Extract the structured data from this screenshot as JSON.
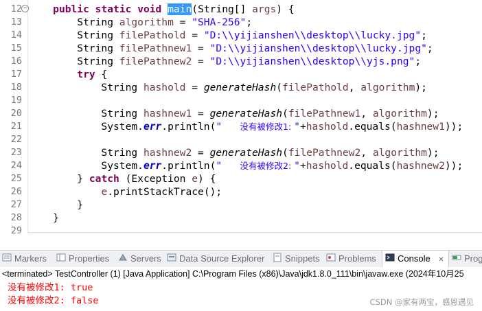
{
  "editor": {
    "lines": [
      {
        "num": "12",
        "tokens": [
          {
            "t": "    "
          },
          {
            "t": "public",
            "c": "kw"
          },
          {
            "t": " "
          },
          {
            "t": "static",
            "c": "kw"
          },
          {
            "t": " "
          },
          {
            "t": "void",
            "c": "kw"
          },
          {
            "t": " "
          },
          {
            "t": "main",
            "c": "sel"
          },
          {
            "t": "(String[] "
          },
          {
            "t": "args",
            "c": "var"
          },
          {
            "t": ") {"
          }
        ]
      },
      {
        "num": "13",
        "tokens": [
          {
            "t": "        String "
          },
          {
            "t": "algorithm",
            "c": "var"
          },
          {
            "t": " = "
          },
          {
            "t": "\"SHA-256\"",
            "c": "str"
          },
          {
            "t": ";"
          }
        ]
      },
      {
        "num": "14",
        "tokens": [
          {
            "t": "        String "
          },
          {
            "t": "filePathold",
            "c": "var"
          },
          {
            "t": " = "
          },
          {
            "t": "\"D:\\\\yijianshen\\\\desktop\\\\lucky.jpg\"",
            "c": "str"
          },
          {
            "t": ";"
          }
        ]
      },
      {
        "num": "15",
        "tokens": [
          {
            "t": "        String "
          },
          {
            "t": "filePathnew1",
            "c": "var"
          },
          {
            "t": " = "
          },
          {
            "t": "\"D:\\\\yijianshen\\\\desktop\\\\lucky.jpg\"",
            "c": "str"
          },
          {
            "t": ";"
          }
        ]
      },
      {
        "num": "16",
        "tokens": [
          {
            "t": "        String "
          },
          {
            "t": "filePathnew2",
            "c": "var"
          },
          {
            "t": " = "
          },
          {
            "t": "\"D:\\\\yijianshen\\\\desktop\\\\yjs.png\"",
            "c": "str"
          },
          {
            "t": ";"
          }
        ]
      },
      {
        "num": "17",
        "tokens": [
          {
            "t": "        "
          },
          {
            "t": "try",
            "c": "kw"
          },
          {
            "t": " {"
          }
        ]
      },
      {
        "num": "18",
        "tokens": [
          {
            "t": "            String "
          },
          {
            "t": "hashold",
            "c": "var"
          },
          {
            "t": " = "
          },
          {
            "t": "generateHash",
            "c": "mth"
          },
          {
            "t": "("
          },
          {
            "t": "filePathold",
            "c": "var"
          },
          {
            "t": ", "
          },
          {
            "t": "algorithm",
            "c": "var"
          },
          {
            "t": ");"
          }
        ]
      },
      {
        "num": "19",
        "tokens": []
      },
      {
        "num": "20",
        "tokens": [
          {
            "t": "            String "
          },
          {
            "t": "hashnew1",
            "c": "var"
          },
          {
            "t": " = "
          },
          {
            "t": "generateHash",
            "c": "mth"
          },
          {
            "t": "("
          },
          {
            "t": "filePathnew1",
            "c": "var"
          },
          {
            "t": ", "
          },
          {
            "t": "algorithm",
            "c": "var"
          },
          {
            "t": ");"
          }
        ]
      },
      {
        "num": "21",
        "tokens": [
          {
            "t": "            System."
          },
          {
            "t": "err",
            "c": "sf"
          },
          {
            "t": ".println("
          },
          {
            "t": "\"   ",
            "c": "str"
          },
          {
            "t": "没有被修改1: ",
            "c": "str cn"
          },
          {
            "t": "\"",
            "c": "str"
          },
          {
            "t": "+"
          },
          {
            "t": "hashold",
            "c": "var"
          },
          {
            "t": ".equals("
          },
          {
            "t": "hashnew1",
            "c": "var"
          },
          {
            "t": "));"
          }
        ]
      },
      {
        "num": "22",
        "tokens": []
      },
      {
        "num": "23",
        "tokens": [
          {
            "t": "            String "
          },
          {
            "t": "hashnew2",
            "c": "var"
          },
          {
            "t": " = "
          },
          {
            "t": "generateHash",
            "c": "mth"
          },
          {
            "t": "("
          },
          {
            "t": "filePathnew2",
            "c": "var"
          },
          {
            "t": ", "
          },
          {
            "t": "algorithm",
            "c": "var"
          },
          {
            "t": ");"
          }
        ]
      },
      {
        "num": "24",
        "tokens": [
          {
            "t": "            System."
          },
          {
            "t": "err",
            "c": "sf"
          },
          {
            "t": ".println("
          },
          {
            "t": "\"   ",
            "c": "str"
          },
          {
            "t": "没有被修改2: ",
            "c": "str cn"
          },
          {
            "t": "\"",
            "c": "str"
          },
          {
            "t": "+"
          },
          {
            "t": "hashold",
            "c": "var"
          },
          {
            "t": ".equals("
          },
          {
            "t": "hashnew2",
            "c": "var"
          },
          {
            "t": "));"
          }
        ]
      },
      {
        "num": "25",
        "tokens": [
          {
            "t": "        } "
          },
          {
            "t": "catch",
            "c": "kw"
          },
          {
            "t": " (Exception "
          },
          {
            "t": "e",
            "c": "var"
          },
          {
            "t": ") {"
          }
        ]
      },
      {
        "num": "26",
        "tokens": [
          {
            "t": "            "
          },
          {
            "t": "e",
            "c": "var"
          },
          {
            "t": ".printStackTrace();"
          }
        ]
      },
      {
        "num": "27",
        "tokens": [
          {
            "t": "        }"
          }
        ]
      },
      {
        "num": "28",
        "tokens": [
          {
            "t": "    }"
          }
        ]
      },
      {
        "num": "29",
        "tokens": []
      }
    ],
    "fold_marker": "−"
  },
  "scrollbar": {
    "left_arrow": "<"
  },
  "views": {
    "tabs": [
      {
        "label": "Markers",
        "icon": "markers-icon"
      },
      {
        "label": "Properties",
        "icon": "properties-icon"
      },
      {
        "label": "Servers",
        "icon": "servers-icon"
      },
      {
        "label": "Data Source Explorer",
        "icon": "data-source-icon"
      },
      {
        "label": "Snippets",
        "icon": "snippets-icon"
      },
      {
        "label": "Problems",
        "icon": "problems-icon"
      },
      {
        "label": "Console",
        "icon": "console-icon",
        "active": true,
        "close": "✕"
      },
      {
        "label": "Prog",
        "icon": "progress-icon"
      }
    ]
  },
  "console": {
    "status": "<terminated> TestController (1) [Java Application] C:\\Program Files (x86)\\Java\\jdk1.8.0_111\\bin\\javaw.exe (2024年10月25",
    "output": [
      "没有被修改1: true",
      "没有被修改2: false"
    ]
  },
  "watermark": "CSDN @家有两宝，感恩遇见",
  "colors": {
    "keyword": "#7f0055",
    "string": "#2a00ff",
    "variable": "#6a3e3e",
    "selection": "#3399ff",
    "error_output": "#ff0000"
  }
}
